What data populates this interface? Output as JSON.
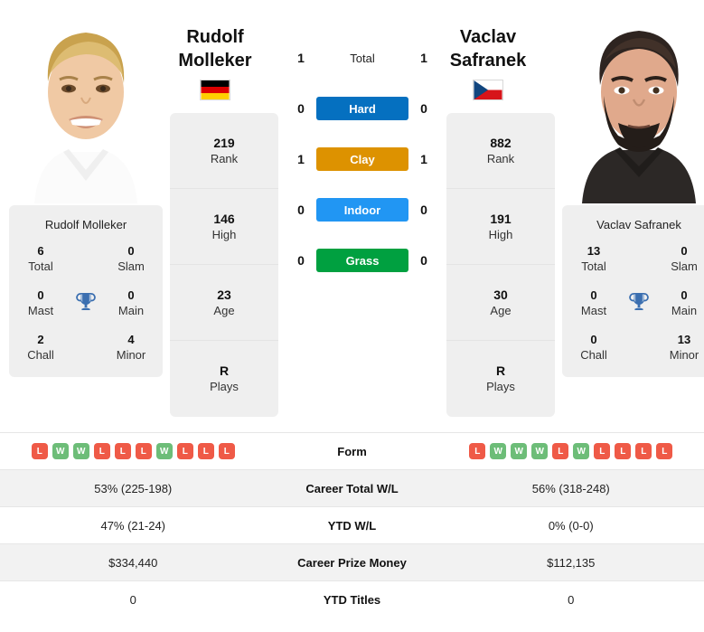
{
  "players": {
    "left": {
      "first_name": "Rudolf",
      "last_name": "Molleker",
      "full_name": "Rudolf Molleker",
      "country": "germany",
      "photo": "blond-male-player-white-shirt",
      "rank": "219",
      "rank_label": "Rank",
      "high": "146",
      "high_label": "High",
      "age": "23",
      "age_label": "Age",
      "plays": "R",
      "plays_label": "Plays",
      "titles": {
        "total": "6",
        "total_label": "Total",
        "slam": "0",
        "slam_label": "Slam",
        "mast": "0",
        "mast_label": "Mast",
        "main": "0",
        "main_label": "Main",
        "chall": "2",
        "chall_label": "Chall",
        "minor": "4",
        "minor_label": "Minor"
      },
      "h2h": {
        "total": "1",
        "hard": "0",
        "clay": "1",
        "indoor": "0",
        "grass": "0"
      },
      "form": [
        "L",
        "W",
        "W",
        "L",
        "L",
        "L",
        "W",
        "L",
        "L",
        "L"
      ],
      "career_total_wl": "53% (225-198)",
      "ytd_wl": "47% (21-24)",
      "career_prize_money": "$334,440",
      "ytd_titles": "0"
    },
    "right": {
      "first_name": "Vaclav",
      "last_name": "Safranek",
      "full_name": "Vaclav Safranek",
      "country": "czech-republic",
      "photo": "dark-haired-bearded-male-player-dark-shirt",
      "rank": "882",
      "rank_label": "Rank",
      "high": "191",
      "high_label": "High",
      "age": "30",
      "age_label": "Age",
      "plays": "R",
      "plays_label": "Plays",
      "titles": {
        "total": "13",
        "total_label": "Total",
        "slam": "0",
        "slam_label": "Slam",
        "mast": "0",
        "mast_label": "Mast",
        "main": "0",
        "main_label": "Main",
        "chall": "0",
        "chall_label": "Chall",
        "minor": "13",
        "minor_label": "Minor"
      },
      "h2h": {
        "total": "1",
        "hard": "0",
        "clay": "1",
        "indoor": "0",
        "grass": "0"
      },
      "form": [
        "L",
        "W",
        "W",
        "W",
        "L",
        "W",
        "L",
        "L",
        "L",
        "L"
      ],
      "career_total_wl": "56% (318-248)",
      "ytd_wl": "0% (0-0)",
      "career_prize_money": "$112,135",
      "ytd_titles": "0"
    }
  },
  "h2h_rows": {
    "total_label": "Total",
    "hard_label": "Hard",
    "clay_label": "Clay",
    "indoor_label": "Indoor",
    "grass_label": "Grass"
  },
  "surface_colors": {
    "hard": "#0570c0",
    "clay": "#dd9200",
    "indoor": "#2196f3",
    "grass": "#00a040"
  },
  "table_labels": {
    "form": "Form",
    "career_total_wl": "Career Total W/L",
    "ytd_wl": "YTD W/L",
    "career_prize_money": "Career Prize Money",
    "ytd_titles": "YTD Titles"
  },
  "colors": {
    "win_badge": "#6dbd78",
    "loss_badge": "#ef5a47",
    "trophy": "#3b6fb0",
    "card_bg": "#efefef",
    "row_shaded": "#f2f2f2"
  }
}
